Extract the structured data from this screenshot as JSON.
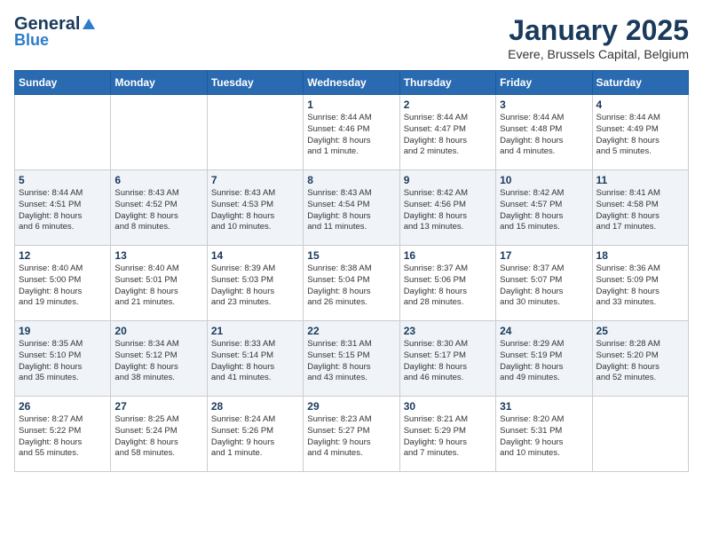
{
  "logo": {
    "general": "General",
    "blue": "Blue",
    "symbol": "▶"
  },
  "title": "January 2025",
  "subtitle": "Evere, Brussels Capital, Belgium",
  "weekdays": [
    "Sunday",
    "Monday",
    "Tuesday",
    "Wednesday",
    "Thursday",
    "Friday",
    "Saturday"
  ],
  "weeks": [
    [
      {
        "day": "",
        "info": ""
      },
      {
        "day": "",
        "info": ""
      },
      {
        "day": "",
        "info": ""
      },
      {
        "day": "1",
        "info": "Sunrise: 8:44 AM\nSunset: 4:46 PM\nDaylight: 8 hours\nand 1 minute."
      },
      {
        "day": "2",
        "info": "Sunrise: 8:44 AM\nSunset: 4:47 PM\nDaylight: 8 hours\nand 2 minutes."
      },
      {
        "day": "3",
        "info": "Sunrise: 8:44 AM\nSunset: 4:48 PM\nDaylight: 8 hours\nand 4 minutes."
      },
      {
        "day": "4",
        "info": "Sunrise: 8:44 AM\nSunset: 4:49 PM\nDaylight: 8 hours\nand 5 minutes."
      }
    ],
    [
      {
        "day": "5",
        "info": "Sunrise: 8:44 AM\nSunset: 4:51 PM\nDaylight: 8 hours\nand 6 minutes."
      },
      {
        "day": "6",
        "info": "Sunrise: 8:43 AM\nSunset: 4:52 PM\nDaylight: 8 hours\nand 8 minutes."
      },
      {
        "day": "7",
        "info": "Sunrise: 8:43 AM\nSunset: 4:53 PM\nDaylight: 8 hours\nand 10 minutes."
      },
      {
        "day": "8",
        "info": "Sunrise: 8:43 AM\nSunset: 4:54 PM\nDaylight: 8 hours\nand 11 minutes."
      },
      {
        "day": "9",
        "info": "Sunrise: 8:42 AM\nSunset: 4:56 PM\nDaylight: 8 hours\nand 13 minutes."
      },
      {
        "day": "10",
        "info": "Sunrise: 8:42 AM\nSunset: 4:57 PM\nDaylight: 8 hours\nand 15 minutes."
      },
      {
        "day": "11",
        "info": "Sunrise: 8:41 AM\nSunset: 4:58 PM\nDaylight: 8 hours\nand 17 minutes."
      }
    ],
    [
      {
        "day": "12",
        "info": "Sunrise: 8:40 AM\nSunset: 5:00 PM\nDaylight: 8 hours\nand 19 minutes."
      },
      {
        "day": "13",
        "info": "Sunrise: 8:40 AM\nSunset: 5:01 PM\nDaylight: 8 hours\nand 21 minutes."
      },
      {
        "day": "14",
        "info": "Sunrise: 8:39 AM\nSunset: 5:03 PM\nDaylight: 8 hours\nand 23 minutes."
      },
      {
        "day": "15",
        "info": "Sunrise: 8:38 AM\nSunset: 5:04 PM\nDaylight: 8 hours\nand 26 minutes."
      },
      {
        "day": "16",
        "info": "Sunrise: 8:37 AM\nSunset: 5:06 PM\nDaylight: 8 hours\nand 28 minutes."
      },
      {
        "day": "17",
        "info": "Sunrise: 8:37 AM\nSunset: 5:07 PM\nDaylight: 8 hours\nand 30 minutes."
      },
      {
        "day": "18",
        "info": "Sunrise: 8:36 AM\nSunset: 5:09 PM\nDaylight: 8 hours\nand 33 minutes."
      }
    ],
    [
      {
        "day": "19",
        "info": "Sunrise: 8:35 AM\nSunset: 5:10 PM\nDaylight: 8 hours\nand 35 minutes."
      },
      {
        "day": "20",
        "info": "Sunrise: 8:34 AM\nSunset: 5:12 PM\nDaylight: 8 hours\nand 38 minutes."
      },
      {
        "day": "21",
        "info": "Sunrise: 8:33 AM\nSunset: 5:14 PM\nDaylight: 8 hours\nand 41 minutes."
      },
      {
        "day": "22",
        "info": "Sunrise: 8:31 AM\nSunset: 5:15 PM\nDaylight: 8 hours\nand 43 minutes."
      },
      {
        "day": "23",
        "info": "Sunrise: 8:30 AM\nSunset: 5:17 PM\nDaylight: 8 hours\nand 46 minutes."
      },
      {
        "day": "24",
        "info": "Sunrise: 8:29 AM\nSunset: 5:19 PM\nDaylight: 8 hours\nand 49 minutes."
      },
      {
        "day": "25",
        "info": "Sunrise: 8:28 AM\nSunset: 5:20 PM\nDaylight: 8 hours\nand 52 minutes."
      }
    ],
    [
      {
        "day": "26",
        "info": "Sunrise: 8:27 AM\nSunset: 5:22 PM\nDaylight: 8 hours\nand 55 minutes."
      },
      {
        "day": "27",
        "info": "Sunrise: 8:25 AM\nSunset: 5:24 PM\nDaylight: 8 hours\nand 58 minutes."
      },
      {
        "day": "28",
        "info": "Sunrise: 8:24 AM\nSunset: 5:26 PM\nDaylight: 9 hours\nand 1 minute."
      },
      {
        "day": "29",
        "info": "Sunrise: 8:23 AM\nSunset: 5:27 PM\nDaylight: 9 hours\nand 4 minutes."
      },
      {
        "day": "30",
        "info": "Sunrise: 8:21 AM\nSunset: 5:29 PM\nDaylight: 9 hours\nand 7 minutes."
      },
      {
        "day": "31",
        "info": "Sunrise: 8:20 AM\nSunset: 5:31 PM\nDaylight: 9 hours\nand 10 minutes."
      },
      {
        "day": "",
        "info": ""
      }
    ]
  ]
}
